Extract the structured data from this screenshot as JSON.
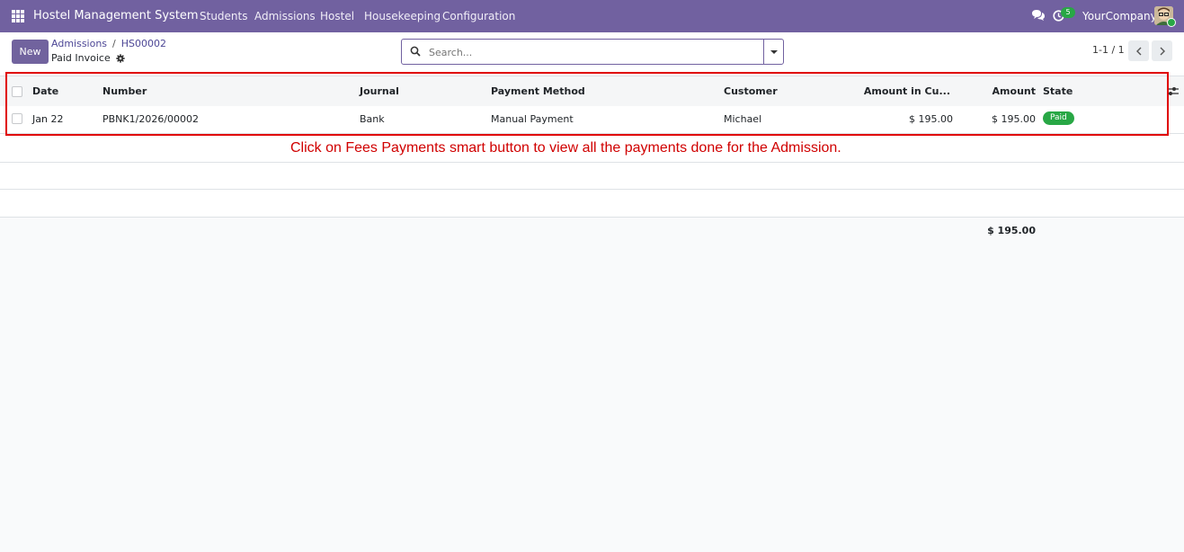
{
  "app": {
    "title": "Hostel Management System",
    "menu": [
      "Students",
      "Admissions",
      "Hostel",
      "Housekeeping",
      "Configuration"
    ],
    "notification_count": "5",
    "company": "YourCompany",
    "brand_color": "#7161a0"
  },
  "control_panel": {
    "new_label": "New",
    "breadcrumb": [
      "Admissions",
      "HS00002"
    ],
    "title": "Paid Invoice",
    "search_placeholder": "Search...",
    "pager": "1-1 / 1"
  },
  "table": {
    "columns": [
      "Date",
      "Number",
      "Journal",
      "Payment Method",
      "Customer",
      "Amount in Cu...",
      "Amount",
      "State"
    ],
    "rows": [
      {
        "date": "Jan 22",
        "number": "PBNK1/2026/00002",
        "journal": "Bank",
        "payment_method": "Manual Payment",
        "customer": "Michael",
        "amount_currency": "$ 195.00",
        "amount": "$ 195.00",
        "state": "Paid"
      }
    ],
    "total_amount": "$ 195.00"
  },
  "annotation": {
    "text": "Click on Fees Payments smart button to view all the payments done for the Admission.",
    "color": "#d00000"
  }
}
